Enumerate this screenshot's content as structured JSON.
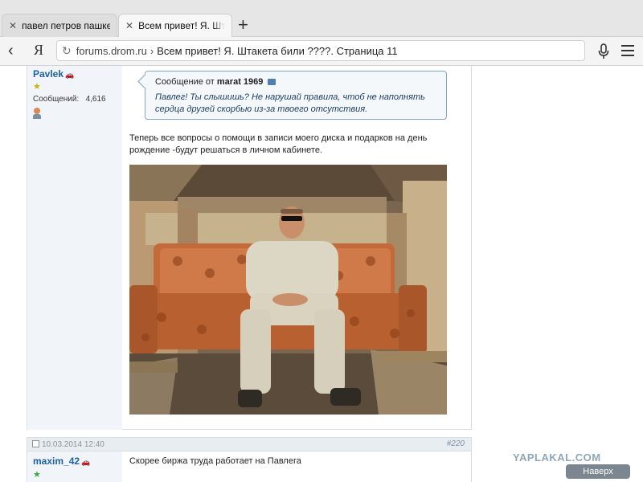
{
  "browser": {
    "tabs": [
      {
        "label": "павел петров пашкет",
        "active": false
      },
      {
        "label": "Всем привет! Я. Штакета",
        "active": true
      }
    ],
    "new_tab_icon": "plus-icon",
    "back_icon": "chevron-left-icon",
    "brand_label": "Я",
    "address": {
      "domain": "forums.drom.ru",
      "separator": "›",
      "title": "Всем привет! Я. Штакета били ????. Страница 11"
    }
  },
  "post1": {
    "username": "Pavlek",
    "msg_count_label": "Сообщений:",
    "msg_count": "4,616",
    "quote": {
      "prefix": "Сообщение от",
      "author": "marat 1969",
      "text": "Павлег! Ты слышишь? Не нарушай правила, чтоб не наполнять сердца друзей скорбью из-за твоего отсутствия."
    },
    "text": "Теперь все вопросы о помощи в записи моего диска и подарков на день рождение -будут решаться в личном кабинете."
  },
  "post2": {
    "date": "10.03.2014 12:40",
    "number": "#220",
    "username": "maxim_42",
    "text": "Скорее биржа труда работает на Павлега"
  },
  "watermark": "YAPLAKAL.COM",
  "up_button": "Наверх",
  "colors": {
    "username": "#1b5fa6",
    "quote_border": "#86a5bd",
    "quote_text": "#1e3e63",
    "userpanel_bg": "#f1f5f9"
  }
}
